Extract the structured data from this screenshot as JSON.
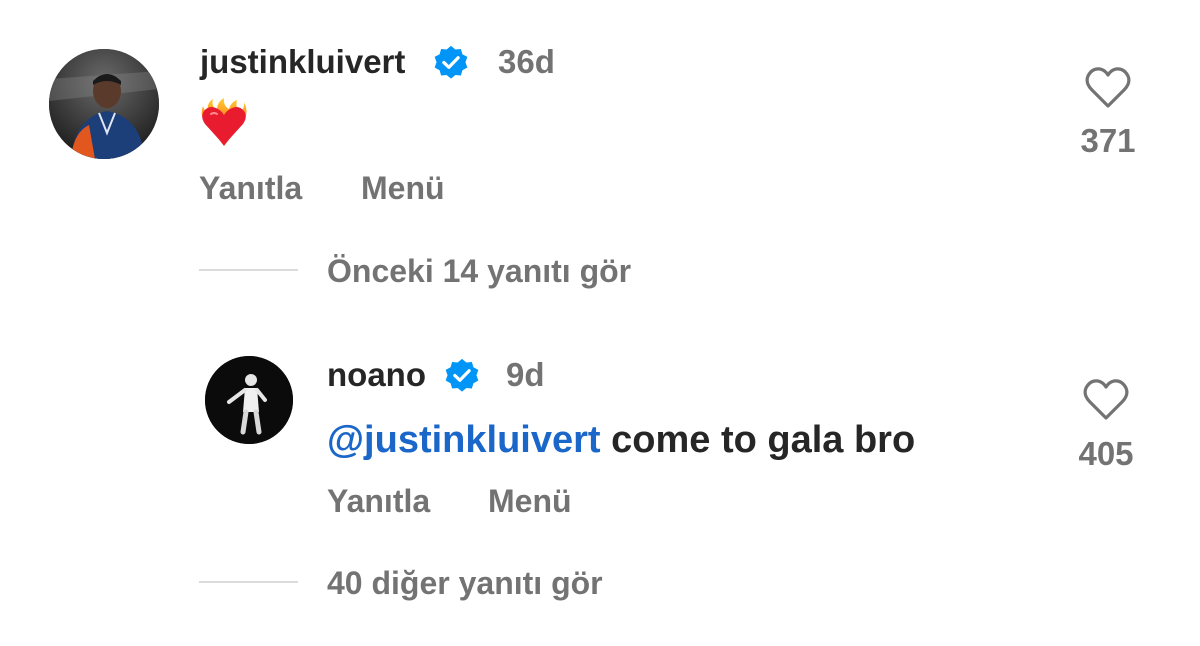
{
  "comment": {
    "username": "justinkluivert",
    "time": "36d",
    "emoji": "❤️‍🔥",
    "likes": "371",
    "reply_label": "Yanıtla",
    "menu_label": "Menü"
  },
  "previous_replies": {
    "label": "Önceki 14 yanıtı gör"
  },
  "reply": {
    "username": "noano",
    "time": "9d",
    "mention": "@justinkluivert",
    "text": " come to gala bro",
    "likes": "405",
    "reply_label": "Yanıtla",
    "menu_label": "Menü"
  },
  "more_replies": {
    "label": "40 diğer yanıtı gör"
  },
  "colors": {
    "verified": "#0095f6",
    "mention": "#1a66c9",
    "muted": "#737373",
    "text": "#262626"
  }
}
